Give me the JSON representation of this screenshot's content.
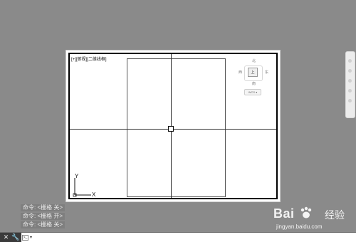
{
  "viewport": {
    "label": "[+][俯视][二维线框]"
  },
  "ucs": {
    "x_label": "X",
    "y_label": "Y"
  },
  "viewcube": {
    "north": "北",
    "south": "南",
    "west": "西",
    "east": "东",
    "face": "上",
    "wcs": "WCS ▾"
  },
  "command_history": [
    "命令: <栅格 关>",
    "命令: <栅格 开>",
    "命令: <栅格 关>"
  ],
  "command_bar": {
    "close_icon": "close-icon",
    "settings_icon": "wrench-icon",
    "input_icon": "command-prompt-icon",
    "input_value": ""
  },
  "watermark": {
    "brand": "Bai",
    "cn": "经验",
    "url": "jingyan.baidu.com"
  },
  "colors": {
    "background": "#8a8a8a",
    "sheet": "#ffffff",
    "toolbar": "#3a3a3a"
  }
}
